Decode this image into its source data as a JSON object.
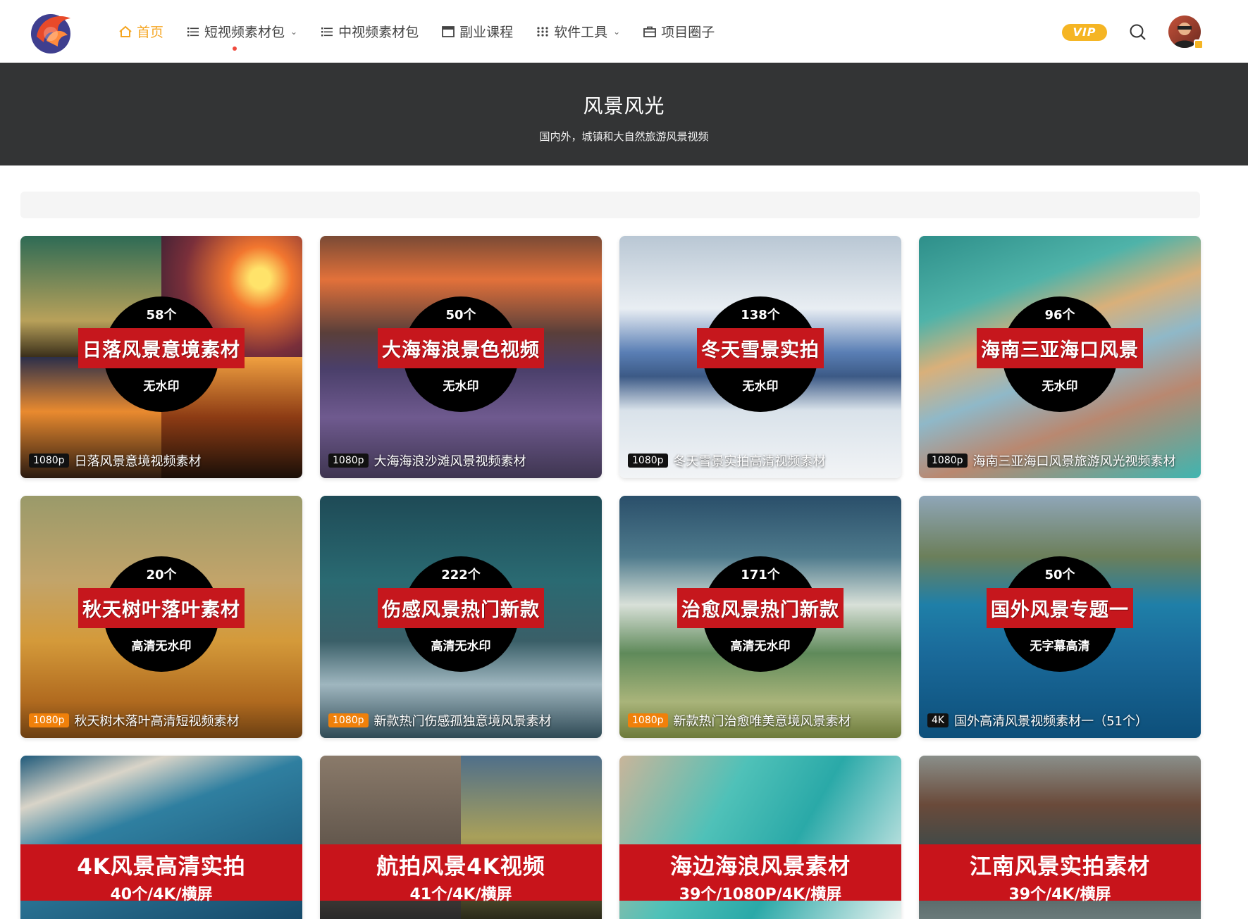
{
  "nav": {
    "items": [
      {
        "label": "首页",
        "icon": "home-icon",
        "caret": ""
      },
      {
        "label": "短视频素材包",
        "icon": "list-icon",
        "caret": "⌄"
      },
      {
        "label": "中视频素材包",
        "icon": "list-icon",
        "caret": ""
      },
      {
        "label": "副业课程",
        "icon": "window-icon",
        "caret": ""
      },
      {
        "label": "软件工具",
        "icon": "grid-icon",
        "caret": "⌄"
      },
      {
        "label": "项目圈子",
        "icon": "briefcase-icon",
        "caret": ""
      }
    ],
    "vip": "VIP"
  },
  "banner": {
    "title": "风景风光",
    "subtitle": "国内外，城镇和大自然旅游风景视频"
  },
  "cards": [
    {
      "count": "58个",
      "title": "日落风景意境素材",
      "sub": "无水印",
      "res": "1080p",
      "caption": "日落风景意境视频素材"
    },
    {
      "count": "50个",
      "title": "大海海浪景色视频",
      "sub": "无水印",
      "res": "1080p",
      "caption": "大海海浪沙滩风景视频素材"
    },
    {
      "count": "138个",
      "title": "冬天雪景实拍",
      "sub": "无水印",
      "res": "1080p",
      "caption": "冬天雪景实拍高清视频素材"
    },
    {
      "count": "96个",
      "title": "海南三亚海口风景",
      "sub": "无水印",
      "res": "1080p",
      "caption": "海南三亚海口风景旅游风光视频素材"
    },
    {
      "count": "20个",
      "title": "秋天树叶落叶素材",
      "sub": "高清无水印",
      "res": "1080p",
      "caption": "秋天树木落叶高清短视频素材"
    },
    {
      "count": "222个",
      "title": "伤感风景热门新款",
      "sub": "高清无水印",
      "res": "1080p",
      "caption": "新款热门伤感孤独意境风景素材"
    },
    {
      "count": "171个",
      "title": "治愈风景热门新款",
      "sub": "高清无水印",
      "res": "1080p",
      "caption": "新款热门治愈唯美意境风景素材"
    },
    {
      "count": "50个",
      "title": "国外风景专题一",
      "sub": "无字幕高清",
      "res": "4K",
      "caption": "国外高清风景视频素材一（51个）"
    },
    {
      "title": "4K风景高清实拍",
      "sub": "40个/4K/横屏"
    },
    {
      "title": "航拍风景4K视频",
      "sub": "41个/4K/横屏"
    },
    {
      "title": "海边海浪风景素材",
      "sub": "39个/1080P/4K/横屏"
    },
    {
      "title": "江南风景实拍素材",
      "sub": "39个/4K/横屏"
    }
  ],
  "colors": {
    "accent": "#f5a623",
    "banner_bg": "#333435",
    "ribbon": "#c6171d",
    "resolution_orange": "#f0800a"
  }
}
